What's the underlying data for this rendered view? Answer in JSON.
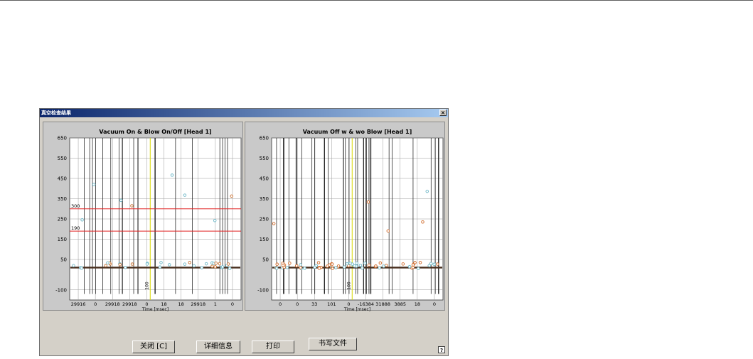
{
  "dialog": {
    "title": "真空检查结果",
    "close_glyph": "×",
    "help_glyph": "?"
  },
  "buttons": {
    "close_label": "关闭 [C]",
    "details_label": "详细信息",
    "print_label": "打印",
    "write_file_label": "书写文件"
  },
  "chart_data": [
    {
      "type": "line",
      "title": "Vacuum On & Blow On/Off [Head 1]",
      "xlabel": "Time [msec]",
      "ylabel": "",
      "ylim": [
        -150,
        650
      ],
      "y_ticks": [
        650,
        550,
        450,
        350,
        250,
        150,
        50,
        -100
      ],
      "x_tick_labels": [
        "29916",
        "0",
        "29918",
        "29918",
        "0",
        "18",
        "18",
        "29918",
        "1",
        "0"
      ],
      "threshold_lines": [
        {
          "label": "300",
          "value": 300,
          "color": "#e02020"
        },
        {
          "label": "190",
          "value": 190,
          "color": "#e02020"
        }
      ],
      "marker_line_label": "100",
      "grid": true
    },
    {
      "type": "line",
      "title": "Vacuum Off w & wo Blow [Head 1]",
      "xlabel": "Time [msec]",
      "ylabel": "",
      "ylim": [
        -150,
        650
      ],
      "y_ticks": [
        650,
        550,
        450,
        350,
        250,
        150,
        50,
        -100
      ],
      "x_tick_labels": [
        "0",
        "0",
        "33",
        "101",
        "0",
        "-16384",
        "31888",
        "3885",
        "18",
        "0"
      ],
      "marker_line_label": "100",
      "grid": true
    }
  ]
}
